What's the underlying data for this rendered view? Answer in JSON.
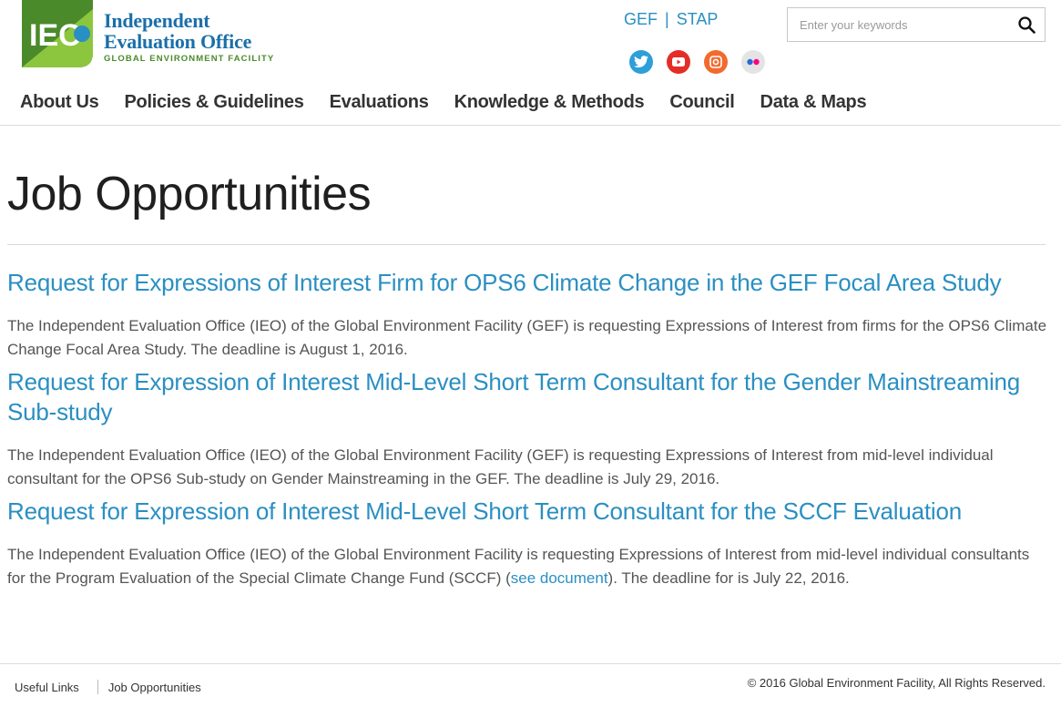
{
  "brand": {
    "mark": "IEO",
    "line1": "Independent",
    "line2": "Evaluation Office",
    "line3": "GLOBAL ENVIRONMENT FACILITY",
    "colors": {
      "blue": "#1a6faa",
      "green": "#4a8a2a",
      "lime": "#8cc63f"
    }
  },
  "toplinks": {
    "gef": "GEF",
    "separator": "|",
    "stap": "STAP"
  },
  "social": [
    {
      "name": "twitter-icon",
      "color": "#2d9fd9"
    },
    {
      "name": "youtube-icon",
      "color": "#e52d27"
    },
    {
      "name": "instagram-icon",
      "color": "#f26a2e"
    },
    {
      "name": "flickr-icon",
      "color": "#e0e0e0"
    }
  ],
  "search": {
    "placeholder": "Enter your keywords",
    "icon": "search-icon"
  },
  "nav": {
    "items": [
      {
        "label": "About Us"
      },
      {
        "label": "Policies & Guidelines"
      },
      {
        "label": "Evaluations"
      },
      {
        "label": "Knowledge & Methods"
      },
      {
        "label": "Council"
      },
      {
        "label": "Data & Maps"
      }
    ]
  },
  "main": {
    "title": "Job Opportunities",
    "jobs": [
      {
        "title": "Request for Expressions of Interest Firm for OPS6 Climate Change in the GEF Focal Area Study",
        "desc": "The Independent Evaluation Office (IEO) of the Global Environment Facility (GEF) is requesting Expressions of Interest from firms for the OPS6 Climate Change Focal Area Study. The deadline is August 1, 2016."
      },
      {
        "title": "Request for Expression of Interest Mid-Level Short Term Consultant for the Gender Mainstreaming Sub-study",
        "desc": "The Independent Evaluation Office (IEO) of the Global Environment Facility (GEF) is requesting Expressions of Interest from mid-level individual consultant for the OPS6 Sub-study on Gender Mainstreaming in the GEF. The deadline is July 29, 2016."
      },
      {
        "title": "Request for Expression of Interest Mid-Level Short Term Consultant for the SCCF Evaluation",
        "desc_before": "The Independent Evaluation Office (IEO) of the Global Environment Facility is requesting Expressions of Interest from mid-level individual consultants for the Program Evaluation of the Special Climate Change Fund (SCCF) (",
        "desc_link": "see document",
        "desc_after": "). The deadline for is July 22, 2016."
      }
    ]
  },
  "footer": {
    "links": [
      "Useful Links",
      "Job Opportunities"
    ],
    "copyright": "© 2016 Global Environment Facility, All Rights Reserved."
  }
}
